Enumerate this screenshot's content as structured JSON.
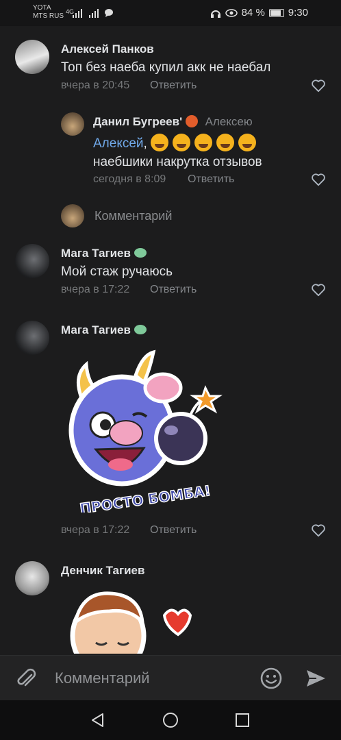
{
  "status": {
    "carrier1": "YOTA",
    "carrier2": "MTS RUS",
    "network": "4G",
    "battery": "84 %",
    "time": "9:30"
  },
  "comments": [
    {
      "name": "Алексей Панков",
      "text": "Топ без наеба купил акк не наебал",
      "time": "вчера в 20:45",
      "reply": "Ответить"
    },
    {
      "name": "Данил Бугреев'",
      "reply_to": "Алексею",
      "mention": "Алексей",
      "text2": "наебшики накрутка отзывов",
      "time": "сегодня в 8:09",
      "reply": "Ответить"
    },
    {
      "placeholder": "Комментарий"
    },
    {
      "name": "Мага Тагиев",
      "text": "Мой стаж ручаюсь",
      "time": "вчера в 17:22",
      "reply": "Ответить"
    },
    {
      "name": "Мага Тагиев",
      "sticker_text": "ПРОСТО БОМБА!",
      "time": "вчера в 17:22",
      "reply": "Ответить"
    },
    {
      "name": "Денчик Тагиев"
    }
  ],
  "composer": {
    "placeholder": "Комментарий"
  },
  "colors": {
    "background": "#1c1c1d",
    "link": "#71aaeb",
    "secondary": "#76787a"
  },
  "icons": [
    "attach-icon",
    "emoji-icon",
    "send-icon",
    "heart-icon",
    "back-icon",
    "home-icon",
    "recents-icon"
  ]
}
